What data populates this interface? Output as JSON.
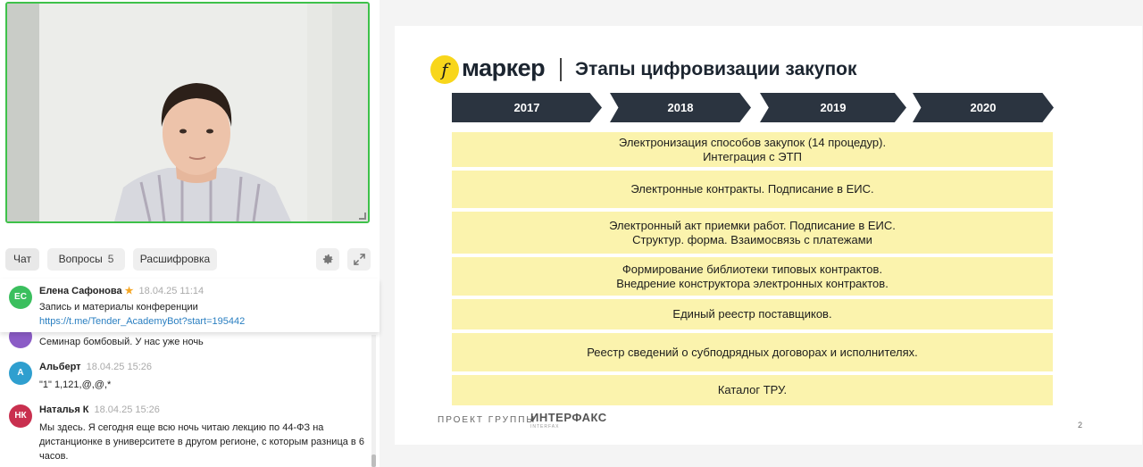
{
  "video": {
    "speaker": "video-participant"
  },
  "tabs": {
    "chat": "Чат",
    "questions": "Вопросы",
    "questions_count": "5",
    "transcript": "Расшифровка"
  },
  "pinned": {
    "initials": "ЕС",
    "author": "Елена Сафонова",
    "star": "★",
    "time": "18.04.25 11:14",
    "text": "Запись и материалы конференции",
    "link": "https://t.me/Tender_AcademyBot?start=195442"
  },
  "messages": [
    {
      "text": "Семинар бомбовый. У нас уже ночь"
    },
    {
      "initials": "А",
      "author": "Альберт",
      "time": "18.04.25 15:26",
      "text": "\"1\" 1,121,@,@,*"
    },
    {
      "initials": "НК",
      "author": "Наталья К",
      "time": "18.04.25 15:26",
      "text": "Мы здесь. Я сегодня еще всю ночь читаю лекцию по 44-ФЗ на дистанционке в университете в другом регионе, с которым разница в 6 часов."
    }
  ],
  "slide": {
    "logo_letter": "f",
    "brand": "маркер",
    "title": "Этапы цифровизации закупок",
    "years": [
      "2017",
      "2018",
      "2019",
      "2020"
    ],
    "rows": [
      [
        "Электронизация способов закупок (14 процедур).",
        "Интеграция с ЭТП"
      ],
      [
        "Электронные контракты. Подписание в ЕИС."
      ],
      [
        "Электронный акт приемки работ. Подписание в ЕИС.",
        "Структур. форма. Взаимосвязь с платежами"
      ],
      [
        "Формирование библиотеки типовых контрактов.",
        "Внедрение конструктора электронных контрактов."
      ],
      [
        "Единый реестр поставщиков."
      ],
      [
        "Реестр сведений о субподрядных договорах и исполнителях."
      ],
      [
        "Каталог ТРУ."
      ]
    ],
    "footer": "ПРОЕКТ ГРУППЫ",
    "group_logo": "ИНТЕРФАКС",
    "group_logo_sub": "INTERFAX",
    "page": "2"
  },
  "colors": {
    "video_border": "#3ec14a",
    "avatar_ec": "#3bbf5e",
    "avatar_purple": "#8b5cc6",
    "avatar_a": "#2f9fcf",
    "avatar_nk": "#c9304f",
    "chevron": "#2b3440",
    "row_fill": "#fbf3ad",
    "logo_yellow": "#f8d61b"
  }
}
